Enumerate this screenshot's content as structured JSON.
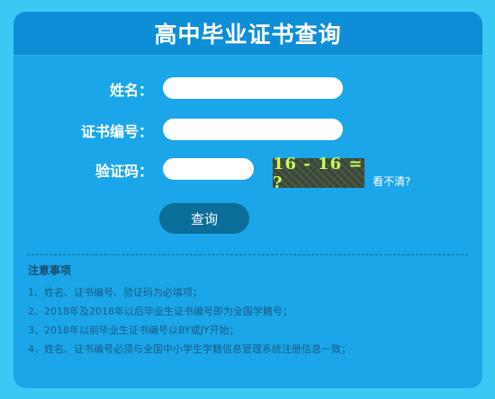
{
  "header": {
    "title": "高中毕业证书查询"
  },
  "form": {
    "name_label": "姓名：",
    "cert_label": "证书编号：",
    "captcha_label": "验证码：",
    "name_value": "",
    "cert_value": "",
    "captcha_value": "",
    "captcha_text": "16 - 16 = ?",
    "refresh_text": "看不清?",
    "submit_label": "查询"
  },
  "notes": {
    "title": "注意事项",
    "items": [
      "1、姓名、证书编号、验证码为必填项；",
      "2、2018年及2018年以后毕业生证书编号即为全国学籍号；",
      "3、2018年以前毕业生证书编号以BY或JY开始；",
      "4、姓名、证书编号必须与全国中小学生学籍信息管理系统注册信息一致；"
    ]
  },
  "colors": {
    "page_background": "#3cc8f5",
    "panel_background": "#1aa6e8",
    "header_background": "#0f8ed8",
    "button_background": "#0b6d99",
    "captcha_text": "#c6ff5a"
  }
}
